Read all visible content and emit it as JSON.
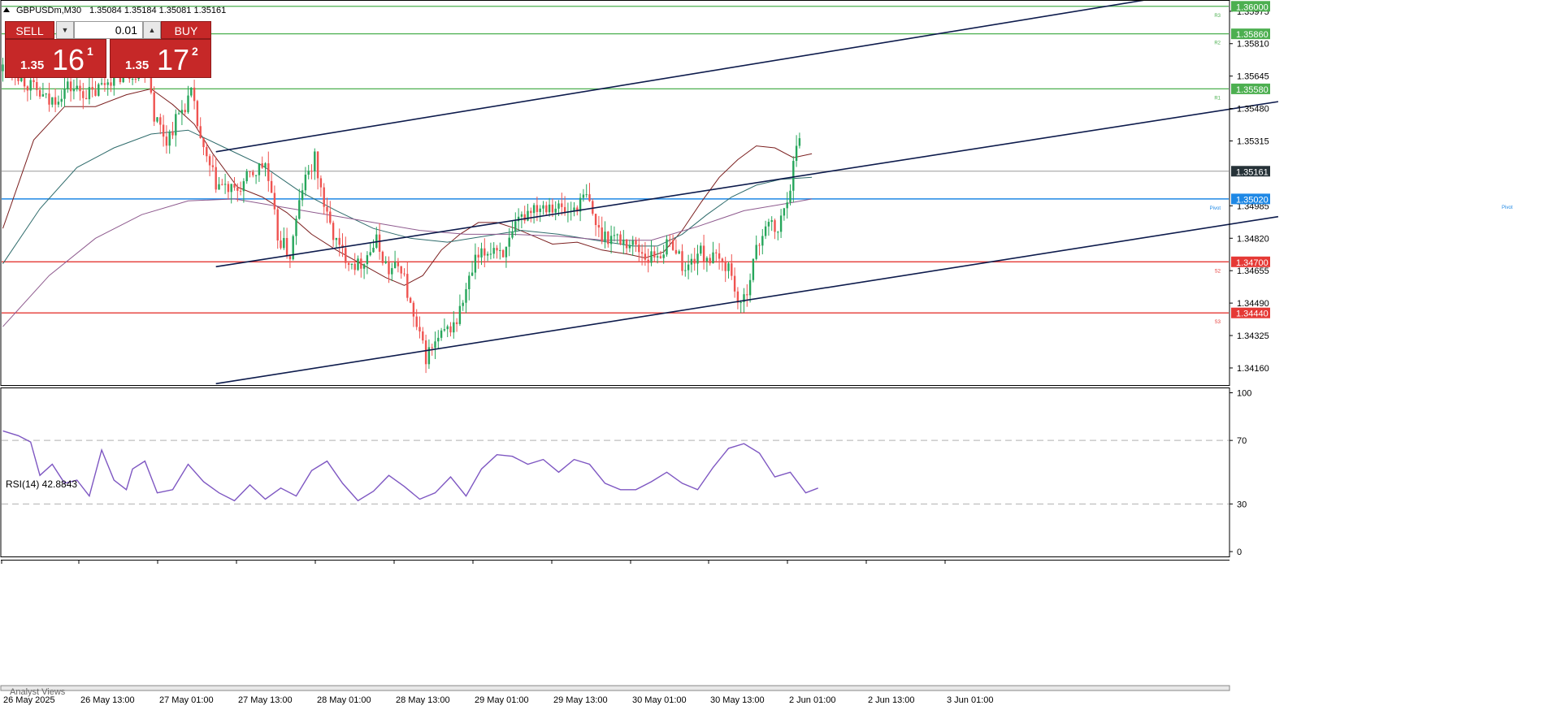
{
  "header": {
    "symbol": "GBPUSDm,M30",
    "ohlc": "1.35084 1.35184 1.35081 1.35161"
  },
  "trade_panel": {
    "sell_label": "SELL",
    "buy_label": "BUY",
    "lot": "0.01",
    "sell_prefix": "1.35",
    "sell_big": "16",
    "sell_sup": "1",
    "buy_prefix": "1.35",
    "buy_big": "17",
    "buy_sup": "2"
  },
  "bottom_panel_label": "Analyst Views",
  "colors": {
    "bull": "#26a65b",
    "bear": "#ef5350",
    "resistance": "#4caf50",
    "support": "#e53935",
    "pivot": "#1e88e5",
    "channel": "#0d1b4c",
    "rsi": "#7e57c2",
    "ma_fast": "#7b1f1f",
    "ma_mid": "#2e6b6b",
    "ma_slow": "#8e5a8e"
  },
  "chart_data": [
    {
      "type": "candlestick",
      "ylim": [
        1.34073,
        1.36028
      ],
      "grid": false,
      "x_ticks": [
        "26 May 2025",
        "26 May 13:00",
        "27 May 01:00",
        "27 May 13:00",
        "28 May 01:00",
        "28 May 13:00",
        "29 May 01:00",
        "29 May 13:00",
        "30 May 01:00",
        "30 May 13:00",
        "2 Jun 01:00",
        "2 Jun 13:00",
        "3 Jun 01:00"
      ],
      "y_ticks": [
        "1.35975",
        "1.35810",
        "1.35645",
        "1.35480",
        "1.35315",
        "1.34985",
        "1.34820",
        "1.34655",
        "1.34490",
        "1.34325",
        "1.34160"
      ],
      "levels": [
        {
          "name": "R3",
          "value": 1.36,
          "label": "1.36000",
          "kind": "resistance"
        },
        {
          "name": "R2",
          "value": 1.3586,
          "label": "1.35860",
          "kind": "resistance"
        },
        {
          "name": "R1",
          "value": 1.3558,
          "label": "1.35580",
          "kind": "resistance"
        },
        {
          "name": "Pivot",
          "value": 1.3502,
          "label": "1.35020",
          "kind": "pivot"
        },
        {
          "name": "S2",
          "value": 1.347,
          "label": "1.34700",
          "kind": "support"
        },
        {
          "name": "S3",
          "value": 1.3444,
          "label": "1.34440",
          "kind": "support"
        }
      ],
      "current_price": {
        "value": 1.35161,
        "label": "1.35161"
      },
      "channel_lines": [
        {
          "name": "upper",
          "from": {
            "bar": 69,
            "price": 1.3526
          },
          "to": {
            "bar": 373,
            "price": 1.3604
          }
        },
        {
          "name": "middle",
          "from": {
            "bar": 69,
            "price": 1.34675
          },
          "to": {
            "bar": 413,
            "price": 1.35515
          }
        },
        {
          "name": "lower",
          "from": {
            "bar": 69,
            "price": 1.3408
          },
          "to": {
            "bar": 413,
            "price": 1.3493
          }
        }
      ],
      "moving_averages": [
        {
          "name": "fast",
          "points": [
            [
              0,
              1.3487
            ],
            [
              10,
              1.3532
            ],
            [
              20,
              1.3549
            ],
            [
              30,
              1.3549
            ],
            [
              40,
              1.3555
            ],
            [
              48,
              1.3558
            ],
            [
              55,
              1.355
            ],
            [
              62,
              1.354
            ],
            [
              68,
              1.3525
            ],
            [
              76,
              1.3508
            ],
            [
              84,
              1.3503
            ],
            [
              92,
              1.3495
            ],
            [
              100,
              1.3484
            ],
            [
              108,
              1.3476
            ],
            [
              116,
              1.3469
            ],
            [
              124,
              1.3462
            ],
            [
              130,
              1.3458
            ],
            [
              136,
              1.3463
            ],
            [
              142,
              1.3476
            ],
            [
              148,
              1.3484
            ],
            [
              154,
              1.349
            ],
            [
              160,
              1.349
            ],
            [
              166,
              1.3487
            ],
            [
              172,
              1.3483
            ],
            [
              178,
              1.3479
            ],
            [
              186,
              1.348
            ],
            [
              194,
              1.3476
            ],
            [
              202,
              1.3474
            ],
            [
              208,
              1.3472
            ],
            [
              214,
              1.3475
            ],
            [
              220,
              1.3486
            ],
            [
              226,
              1.35
            ],
            [
              232,
              1.3513
            ],
            [
              238,
              1.3522
            ],
            [
              244,
              1.3529
            ],
            [
              250,
              1.3528
            ],
            [
              256,
              1.3523
            ],
            [
              262,
              1.3525
            ]
          ]
        },
        {
          "name": "mid",
          "points": [
            [
              0,
              1.3469
            ],
            [
              12,
              1.3497
            ],
            [
              24,
              1.3518
            ],
            [
              36,
              1.3528
            ],
            [
              48,
              1.3535
            ],
            [
              60,
              1.3537
            ],
            [
              72,
              1.3528
            ],
            [
              84,
              1.3519
            ],
            [
              96,
              1.3506
            ],
            [
              108,
              1.3496
            ],
            [
              120,
              1.3487
            ],
            [
              132,
              1.3482
            ],
            [
              144,
              1.348
            ],
            [
              156,
              1.3483
            ],
            [
              168,
              1.3486
            ],
            [
              180,
              1.3484
            ],
            [
              192,
              1.3481
            ],
            [
              204,
              1.3478
            ],
            [
              212,
              1.3478
            ],
            [
              220,
              1.3484
            ],
            [
              228,
              1.3494
            ],
            [
              236,
              1.3503
            ],
            [
              244,
              1.3509
            ],
            [
              252,
              1.3512
            ],
            [
              262,
              1.3513
            ]
          ]
        },
        {
          "name": "slow",
          "points": [
            [
              0,
              1.3437
            ],
            [
              15,
              1.3463
            ],
            [
              30,
              1.3482
            ],
            [
              45,
              1.3494
            ],
            [
              60,
              1.3501
            ],
            [
              75,
              1.3502
            ],
            [
              90,
              1.3498
            ],
            [
              105,
              1.3494
            ],
            [
              120,
              1.349
            ],
            [
              135,
              1.3486
            ],
            [
              150,
              1.3484
            ],
            [
              165,
              1.3484
            ],
            [
              180,
              1.3483
            ],
            [
              195,
              1.3481
            ],
            [
              210,
              1.3481
            ],
            [
              225,
              1.3488
            ],
            [
              240,
              1.3496
            ],
            [
              255,
              1.35
            ],
            [
              262,
              1.3502
            ]
          ]
        }
      ]
    },
    {
      "type": "line",
      "title": "RSI(14) 42.8843",
      "ylim": [
        0,
        100
      ],
      "y_ticks": [
        "100",
        "70",
        "30",
        "0"
      ],
      "guides": [
        70,
        30
      ],
      "series": [
        {
          "name": "RSI(14)",
          "x": [
            0,
            5,
            9,
            12,
            16,
            20,
            24,
            28,
            32,
            36,
            40,
            42,
            46,
            50,
            55,
            60,
            65,
            70,
            75,
            80,
            85,
            90,
            95,
            100,
            105,
            110,
            115,
            120,
            125,
            130,
            135,
            140,
            145,
            150,
            155,
            160,
            165,
            170,
            175,
            180,
            185,
            190,
            195,
            200,
            205,
            210,
            215,
            220,
            225,
            230,
            235,
            240,
            245,
            250,
            255,
            260,
            264
          ],
          "values": [
            76,
            73,
            69,
            48,
            55,
            43,
            45,
            35,
            64,
            45,
            39,
            52,
            57,
            37,
            39,
            55,
            44,
            37,
            32,
            42,
            33,
            40,
            35,
            51,
            57,
            43,
            32,
            38,
            48,
            41,
            33,
            37,
            47,
            35,
            52,
            61,
            60,
            55,
            58,
            50,
            58,
            55,
            43,
            39,
            39,
            44,
            50,
            43,
            39,
            53,
            65,
            68,
            62,
            47,
            50,
            37,
            40
          ]
        }
      ]
    }
  ]
}
